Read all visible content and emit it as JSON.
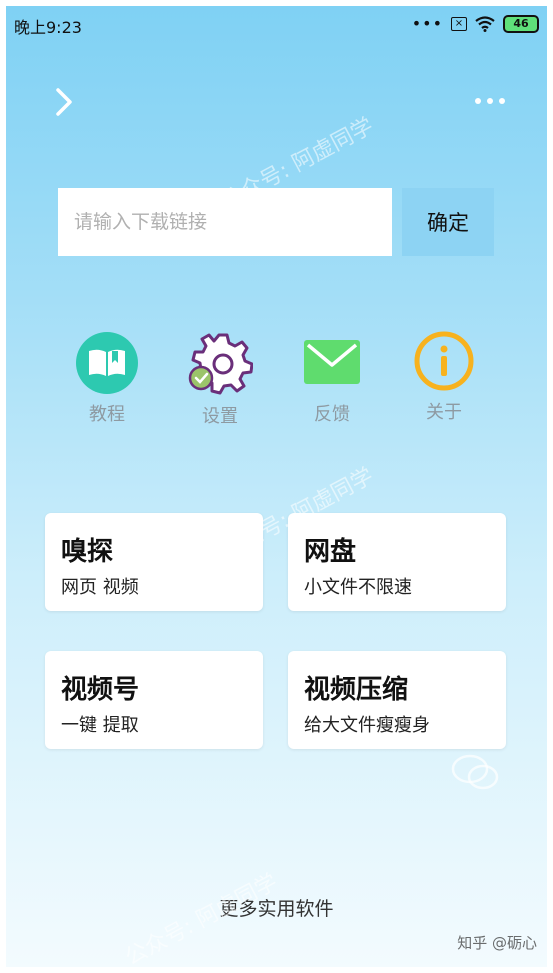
{
  "status_bar": {
    "time": "晚上9:23",
    "battery": "46",
    "more_dots": "•••",
    "sim_mark": "×"
  },
  "header": {
    "back_icon": "chevron-right-icon",
    "more_icon": "more-dots-icon"
  },
  "search": {
    "placeholder": "请输入下载链接",
    "confirm_label": "确定"
  },
  "quick_actions": [
    {
      "label": "教程",
      "icon": "book-icon",
      "color": "#2dc9b0"
    },
    {
      "label": "设置",
      "icon": "gear-icon",
      "color": "#6a2f7a"
    },
    {
      "label": "反馈",
      "icon": "mail-icon",
      "color": "#5fdc6e"
    },
    {
      "label": "关于",
      "icon": "info-icon",
      "color": "#f7b21e"
    }
  ],
  "cards": [
    {
      "title": "嗅探",
      "subtitle": "网页 视频"
    },
    {
      "title": "网盘",
      "subtitle": "小文件不限速"
    },
    {
      "title": "视频号",
      "subtitle": "一键 提取"
    },
    {
      "title": "视频压缩",
      "subtitle": "给大文件瘦瘦身"
    }
  ],
  "footer": {
    "more_software": "更多实用软件"
  },
  "watermarks": {
    "wechat": "公众号: 阿虚同学",
    "zhihu": "知乎 @砺心"
  }
}
